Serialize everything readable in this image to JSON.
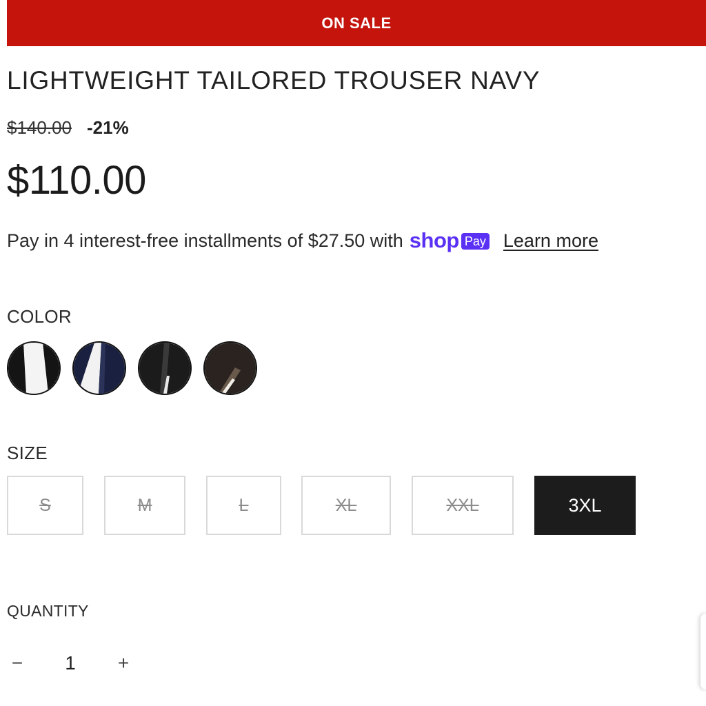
{
  "banner": {
    "text": "ON SALE",
    "color": "#c4140c"
  },
  "product": {
    "title": "LIGHTWEIGHT TAILORED TROUSER NAVY",
    "compare_price": "$140.00",
    "discount": "-21%",
    "price": "$110.00"
  },
  "installments": {
    "text": "Pay in 4 interest-free installments of $27.50 with",
    "brand_word": "shop",
    "brand_badge": "Pay",
    "brand_color": "#5a31f4",
    "link": "Learn more"
  },
  "color": {
    "label": "COLOR",
    "swatches": [
      {
        "name": "white",
        "fill": "#f4f4f4"
      },
      {
        "name": "navy",
        "fill": "#1a2140"
      },
      {
        "name": "black",
        "fill": "#1b1b1b"
      },
      {
        "name": "brown",
        "fill": "#2a231f"
      }
    ]
  },
  "size": {
    "label": "SIZE",
    "options": [
      {
        "label": "S",
        "available": false
      },
      {
        "label": "M",
        "available": false
      },
      {
        "label": "L",
        "available": false
      },
      {
        "label": "XL",
        "available": false
      },
      {
        "label": "XXL",
        "available": false
      },
      {
        "label": "3XL",
        "available": true,
        "selected": true
      }
    ]
  },
  "quantity": {
    "label": "QUANTITY",
    "minus": "−",
    "value": "1",
    "plus": "+"
  }
}
